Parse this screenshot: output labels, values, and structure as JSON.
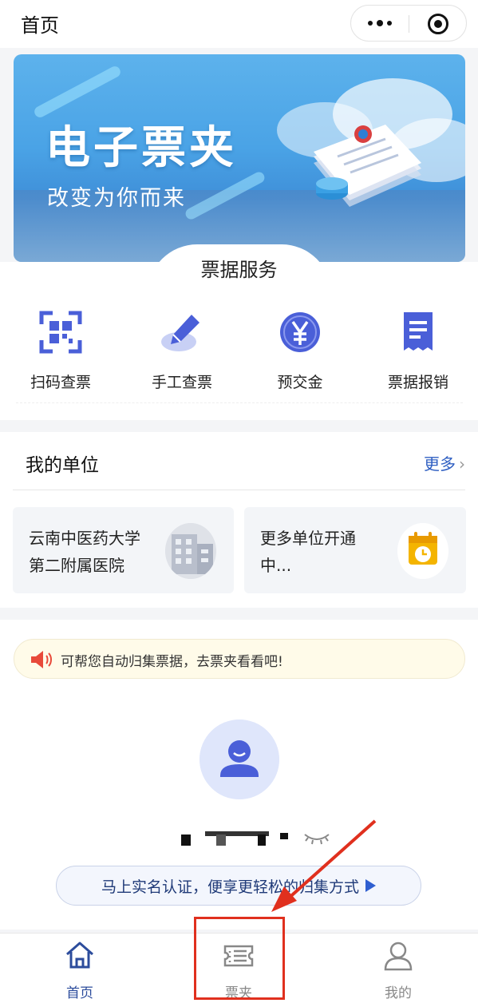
{
  "topbar": {
    "title": "首页"
  },
  "banner": {
    "headline": "电子票夹",
    "subline": "改变为你而来"
  },
  "services": {
    "title": "票据服务",
    "items": [
      {
        "label": "扫码查票",
        "icon": "qr-scan-icon"
      },
      {
        "label": "手工查票",
        "icon": "pen-icon"
      },
      {
        "label": "预交金",
        "icon": "yen-coin-icon"
      },
      {
        "label": "票据报销",
        "icon": "receipt-icon"
      }
    ]
  },
  "units": {
    "title": "我的单位",
    "more_label": "更多",
    "cards": [
      {
        "name_line1": "云南中医药大学",
        "name_line2": "第二附属医院",
        "icon": "building-icon"
      },
      {
        "name_line1": "更多单位开通",
        "name_line2": "中...",
        "icon": "calendar-clock-icon"
      }
    ]
  },
  "notice": {
    "text": "可帮您自动归集票据，去票夹看看吧!"
  },
  "profile": {
    "verify_label": "马上实名认证，便享更轻松的归集方式"
  },
  "tabbar": {
    "items": [
      {
        "label": "首页",
        "icon": "home-icon",
        "active": true
      },
      {
        "label": "票夹",
        "icon": "ticket-folder-icon",
        "active": false
      },
      {
        "label": "我的",
        "icon": "user-icon",
        "active": false
      }
    ]
  },
  "colors": {
    "primary": "#2c4c9c",
    "icon_blue": "#4a5fd8",
    "annotation_red": "#e0301e"
  }
}
